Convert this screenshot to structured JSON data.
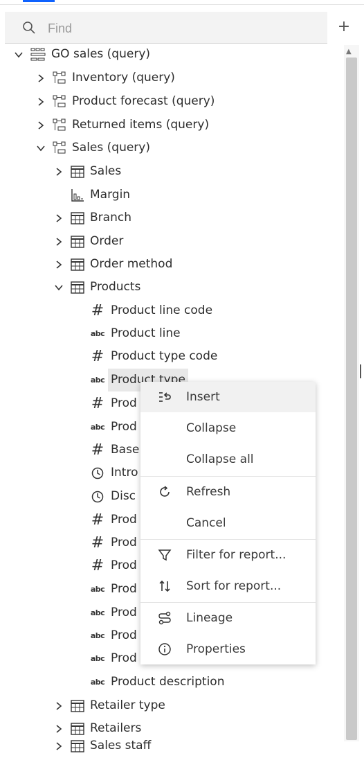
{
  "search": {
    "placeholder": "Find",
    "add_label": "+"
  },
  "tree": {
    "root": "GO sales (query)",
    "queries": [
      "Inventory (query)",
      "Product forecast (query)",
      "Returned items (query)",
      "Sales (query)"
    ],
    "sales_children": [
      "Sales",
      "Margin",
      "Branch",
      "Order",
      "Order method",
      "Products"
    ],
    "product_columns": [
      "Product line code",
      "Product line",
      "Product type code",
      "Product type",
      "Prod",
      "Prod",
      "Base",
      "Intro",
      "Disc",
      "Prod",
      "Prod",
      "Prod",
      "Prod",
      "Prod",
      "Prod",
      "Prod",
      "Product description"
    ],
    "after_products": [
      "Retailer type",
      "Retailers",
      "Sales staff"
    ]
  },
  "context_menu": {
    "items": [
      "Insert",
      "Collapse",
      "Collapse all",
      "Refresh",
      "Cancel",
      "Filter for report...",
      "Sort for report...",
      "Lineage",
      "Properties"
    ]
  },
  "icons": {
    "hash": "#",
    "abc": "abc"
  },
  "colors": {
    "accent": "#0f62fe",
    "hover": "#f1f1f1",
    "selected": "#e8e8e8"
  }
}
